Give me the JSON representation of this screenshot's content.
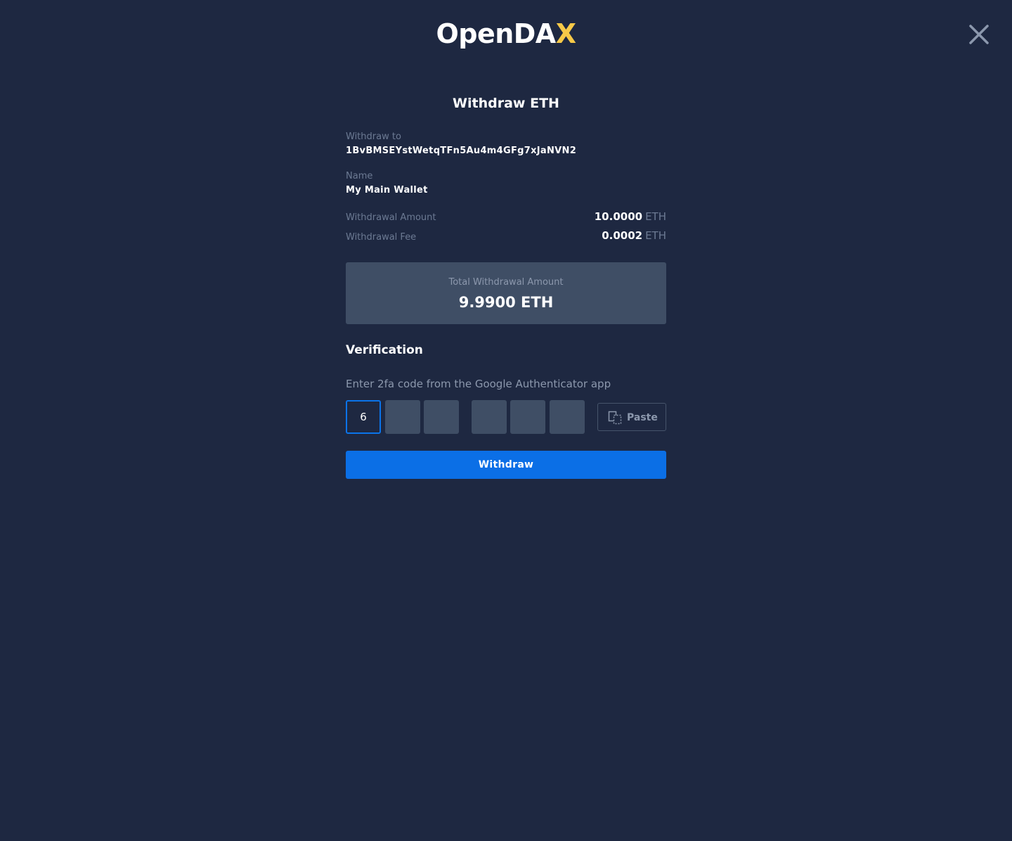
{
  "brand": {
    "logo_text_main": "OpenDA",
    "logo_text_accent": "X",
    "accent_color": "#f7c948"
  },
  "header": {
    "close_icon": "close-icon"
  },
  "modal": {
    "title": "Withdraw ETH",
    "withdraw_to_label": "Withdraw to",
    "withdraw_to_value": "1BvBMSEYstWetqTFn5Au4m4GFg7xJaNVN2",
    "name_label": "Name",
    "name_value": "My Main Wallet",
    "amount_label": "Withdrawal Amount",
    "amount_value": "10.0000",
    "amount_currency": "ETH",
    "fee_label": "Withdrawal Fee",
    "fee_value": "0.0002",
    "fee_currency": "ETH",
    "total_label": "Total Withdrawal Amount",
    "total_value": "9.9900 ETH"
  },
  "verification": {
    "title": "Verification",
    "hint": "Enter 2fa code from the Google Authenticator app",
    "digits": [
      "6",
      "",
      "",
      "",
      "",
      ""
    ],
    "paste_label": "Paste",
    "paste_icon": "paste-icon"
  },
  "actions": {
    "withdraw_label": "Withdraw",
    "primary_color": "#0b6fe6"
  }
}
